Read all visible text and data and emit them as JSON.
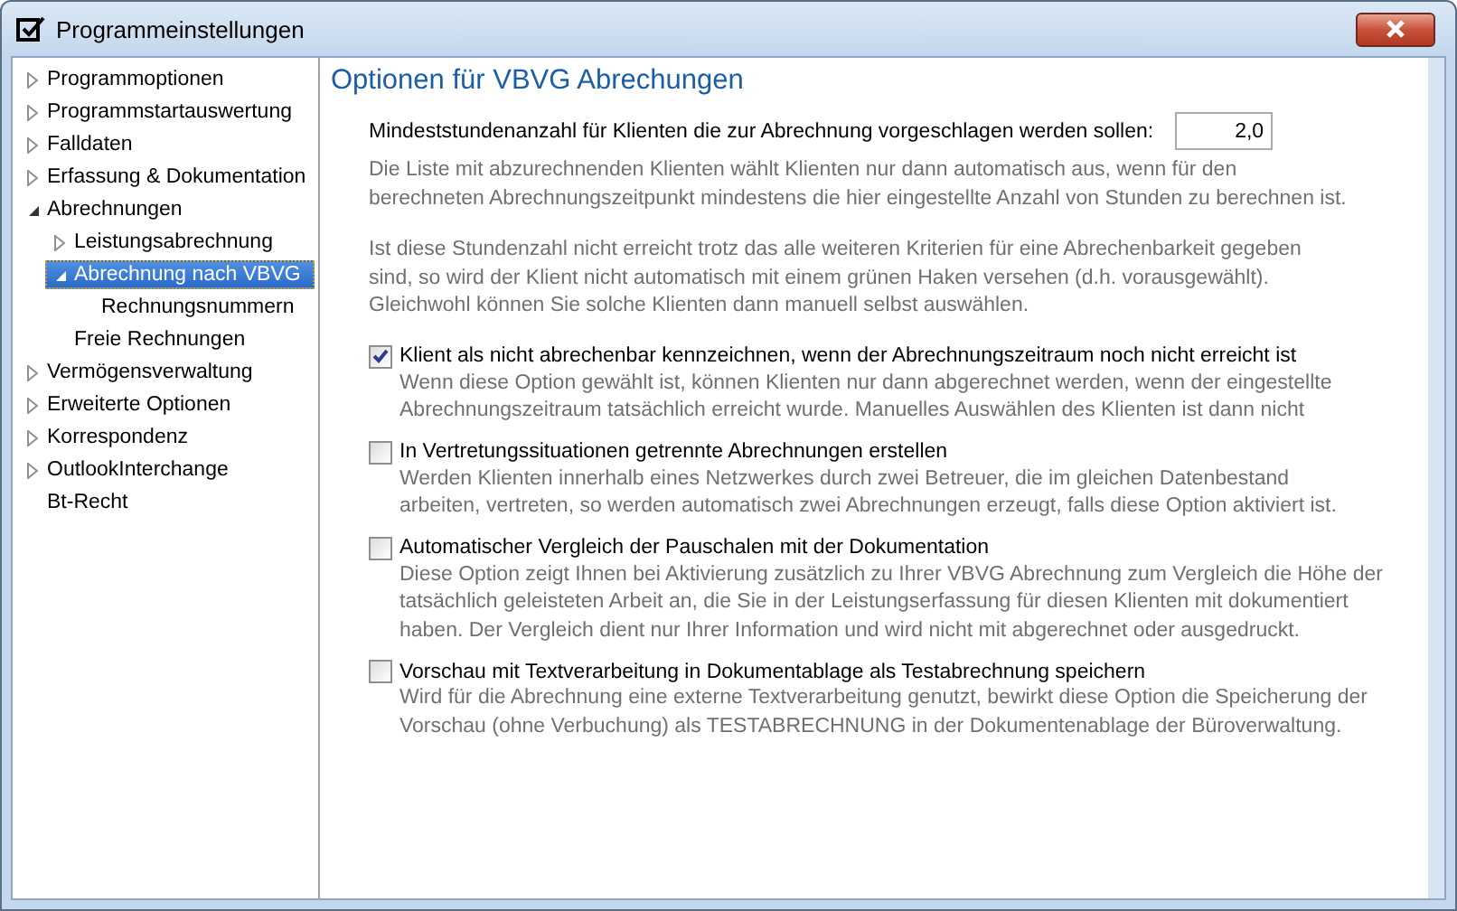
{
  "window": {
    "title": "Programmeinstellungen"
  },
  "sidebar": {
    "items": [
      {
        "label": "Programmoptionen",
        "expandable": true,
        "expanded": false,
        "selected": false
      },
      {
        "label": "Programmstartauswertung",
        "expandable": true,
        "expanded": false,
        "selected": false
      },
      {
        "label": "Falldaten",
        "expandable": true,
        "expanded": false,
        "selected": false
      },
      {
        "label": "Erfassung & Dokumentation",
        "expandable": true,
        "expanded": false,
        "selected": false
      },
      {
        "label": "Abrechnungen",
        "expandable": true,
        "expanded": true,
        "selected": false,
        "children": [
          {
            "label": "Leistungsabrechnung",
            "expandable": true,
            "expanded": false,
            "selected": false
          },
          {
            "label": "Abrechnung nach VBVG",
            "expandable": true,
            "expanded": true,
            "selected": true,
            "children": [
              {
                "label": "Rechnungsnummern",
                "expandable": false,
                "selected": false
              }
            ]
          },
          {
            "label": "Freie Rechnungen",
            "expandable": false,
            "selected": false
          }
        ]
      },
      {
        "label": "Vermögensverwaltung",
        "expandable": true,
        "expanded": false,
        "selected": false
      },
      {
        "label": "Erweiterte Optionen",
        "expandable": true,
        "expanded": false,
        "selected": false
      },
      {
        "label": "Korrespondenz",
        "expandable": true,
        "expanded": false,
        "selected": false
      },
      {
        "label": "OutlookInterchange",
        "expandable": true,
        "expanded": false,
        "selected": false
      },
      {
        "label": "Bt-Recht",
        "expandable": false,
        "selected": false
      }
    ]
  },
  "content": {
    "heading": "Optionen für VBVG Abrechungen",
    "min_hours": {
      "label": "Mindeststundenanzahl für Klienten die zur Abrechnung vorgeschlagen werden sollen:",
      "value": "2,0"
    },
    "notes": [
      "Die Liste mit abzurechnenden Klienten wählt Klienten nur dann automatisch aus, wenn für den\nberechneten Abrechnungszeitpunkt mindestens die hier eingestellte Anzahl von Stunden zu berechnen ist.",
      "Ist diese Stundenzahl nicht erreicht trotz das alle weiteren Kriterien für eine Abrechenbarkeit gegeben\nsind, so wird der Klient nicht automatisch mit einem grünen Haken versehen (d.h. vorausgewählt).\nGleichwohl können Sie solche Klienten dann manuell selbst auswählen."
    ],
    "options": [
      {
        "label": "Klient als nicht abrechenbar kennzeichnen, wenn der Abrechnungszeitraum noch nicht erreicht ist",
        "checked": true,
        "description": "Wenn diese Option gewählt ist, können Klienten nur dann abgerechnet werden, wenn der eingestellte\nAbrechnungszeitraum tatsächlich erreicht wurde. Manuelles Auswählen des Klienten ist dann nicht"
      },
      {
        "label": "In Vertretungssituationen getrennte Abrechnungen erstellen",
        "checked": false,
        "description": "Werden Klienten innerhalb eines Netzwerkes durch zwei Betreuer, die im gleichen Datenbestand\narbeiten, vertreten, so werden automatisch zwei Abrechnungen erzeugt, falls diese Option aktiviert ist."
      },
      {
        "label": "Automatischer Vergleich der Pauschalen mit der Dokumentation",
        "checked": false,
        "description": "Diese Option zeigt Ihnen bei Aktivierung zusätzlich zu Ihrer VBVG Abrechnung zum Vergleich die Höhe der\ntatsächlich geleisteten Arbeit an, die Sie in der Leistungserfassung für diesen Klienten mit dokumentiert\nhaben. Der Vergleich dient nur Ihrer Information und wird nicht mit abgerechnet oder ausgedruckt."
      },
      {
        "label": "Vorschau mit Textverarbeitung in Dokumentablage als Testabrechnung speichern",
        "checked": false,
        "description": "Wird für die Abrechnung eine externe Textverarbeitung genutzt, bewirkt diese Option die Speicherung der\nVorschau (ohne Verbuchung) als TESTABRECHNUNG in der Dokumentenablage der Büroverwaltung."
      }
    ]
  }
}
